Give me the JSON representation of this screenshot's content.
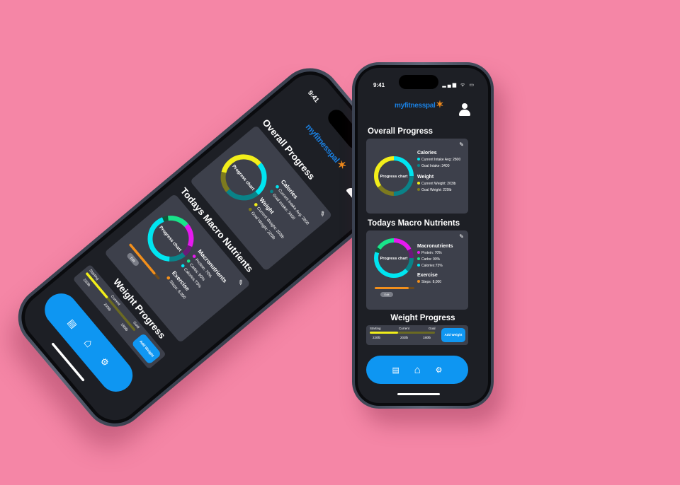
{
  "status": {
    "time": "9:41",
    "signal": "▂▄▆ ᯤ ▭"
  },
  "header": {
    "logo": "myfitnesspal",
    "avatar_icon": "user-icon"
  },
  "overall": {
    "title": "Overall Progress",
    "chart_label": "Progress chart",
    "calories_title": "Calories",
    "current_intake": "Current Intake Avg: 2800",
    "goal_intake": "Goal Intake: 3400",
    "weight_title": "Weight",
    "current_weight": "Current Weight: 203lb",
    "goal_weight": "Goal Weight: 220lb",
    "segments": [
      {
        "color": "#00e5f0",
        "frac": 0.25
      },
      {
        "color": "#0a8288",
        "frac": 0.25
      },
      {
        "color": "#7d7a1f",
        "frac": 0.15
      },
      {
        "color": "#f2ee1a",
        "frac": 0.35
      }
    ]
  },
  "macros": {
    "title": "Todays Macro Nutrients",
    "chart_label": "Progress chart",
    "macro_title": "Macronutrients",
    "protein": "Protein: 70%",
    "carbs": "Carbs: 90%",
    "calories": "Calories:73%",
    "exercise_title": "Exercise",
    "steps": "Steps: 8,000",
    "steps_progress": 0.85,
    "edit_label": "Edit",
    "colors": {
      "protein": "#e619ef",
      "carbs": "#19e38a",
      "calories": "#00e5f0",
      "steps": "#f28f1c"
    },
    "segments": [
      {
        "color": "#e619ef",
        "frac": 0.17
      },
      {
        "color": "#6a1a78",
        "frac": 0.08
      },
      {
        "color": "#0a8288",
        "frac": 0.12
      },
      {
        "color": "#00e5f0",
        "frac": 0.43
      },
      {
        "color": "#0e5a3a",
        "frac": 0.04
      },
      {
        "color": "#19e38a",
        "frac": 0.16
      }
    ]
  },
  "weight": {
    "title": "Weight Progress",
    "starting_label": "Starting",
    "starting_value": "220lb",
    "current_label": "Current",
    "current_value": "203lb",
    "goal_label": "Goal",
    "goal_value": "180lb",
    "progress": 0.43,
    "add_label": "Add Weight"
  },
  "nav": {
    "items": [
      {
        "icon": "notebook-icon",
        "glyph": "▤"
      },
      {
        "icon": "home-icon",
        "glyph": "⌂"
      },
      {
        "icon": "settings-icon",
        "glyph": "⚙"
      }
    ]
  },
  "colors": {
    "background": "#f586a6",
    "screen": "#1d1f25",
    "card": "#3d404b",
    "accent": "#0e96f2"
  }
}
